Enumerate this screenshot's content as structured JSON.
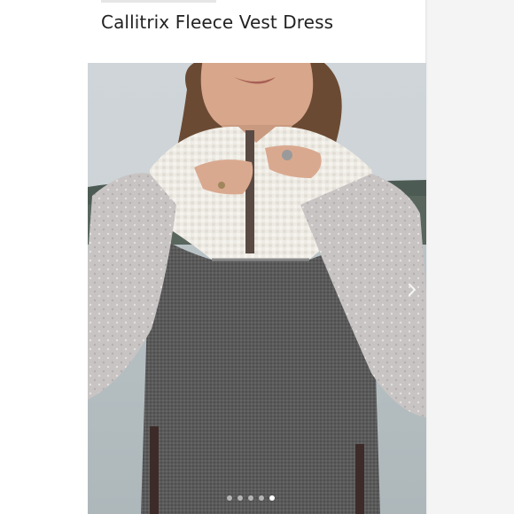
{
  "product": {
    "title": "Callitrix Fleece Vest Dress"
  },
  "gallery": {
    "image_label": "product-photo",
    "slide_count": 5,
    "active_slide": 5,
    "next_icon": "chevron-right-icon"
  },
  "colors": {
    "title_text": "#222222",
    "page_bg": "#ffffff"
  }
}
